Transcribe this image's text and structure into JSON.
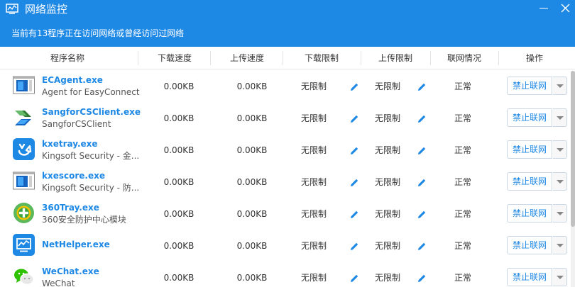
{
  "window": {
    "title": "网络监控",
    "subtitle": "当前有13程序正在访问网络或曾经访问过网络",
    "accent": "#1e88e5"
  },
  "header": {
    "program": "程序名称",
    "download_speed": "下载速度",
    "upload_speed": "上传速度",
    "download_limit": "下载限制",
    "upload_limit": "上传限制",
    "net_status": "联网情况",
    "action": "操作"
  },
  "rows": [
    {
      "name": "ECAgent.exe",
      "desc": "Agent for EasyConnect",
      "icon": "ecagent-icon",
      "down": "0.00KB",
      "up": "0.00KB",
      "dl_limit": "无限制",
      "ul_limit": "无限制",
      "status": "正常",
      "action": "禁止联网"
    },
    {
      "name": "SangforCSClient.exe",
      "desc": "SangforCSClient",
      "icon": "sangfor-icon",
      "down": "0.00KB",
      "up": "0.00KB",
      "dl_limit": "无限制",
      "ul_limit": "无限制",
      "status": "正常",
      "action": "禁止联网"
    },
    {
      "name": "kxetray.exe",
      "desc": "Kingsoft Security - 金...",
      "icon": "kxetray-icon",
      "down": "0.00KB",
      "up": "0.00KB",
      "dl_limit": "无限制",
      "ul_limit": "无限制",
      "status": "正常",
      "action": "禁止联网"
    },
    {
      "name": "kxescore.exe",
      "desc": "Kingsoft Security - 防...",
      "icon": "kxescore-icon",
      "down": "0.00KB",
      "up": "0.00KB",
      "dl_limit": "无限制",
      "ul_limit": "无限制",
      "status": "正常",
      "action": "禁止联网"
    },
    {
      "name": "360Tray.exe",
      "desc": "360安全防护中心模块",
      "icon": "360-icon",
      "down": "0.00KB",
      "up": "0.00KB",
      "dl_limit": "无限制",
      "ul_limit": "无限制",
      "status": "正常",
      "action": "禁止联网"
    },
    {
      "name": "NetHelper.exe",
      "desc": "",
      "icon": "nethelper-icon",
      "down": "0.00KB",
      "up": "0.00KB",
      "dl_limit": "无限制",
      "ul_limit": "无限制",
      "status": "正常",
      "action": "禁止联网"
    },
    {
      "name": "WeChat.exe",
      "desc": "WeChat",
      "icon": "wechat-icon",
      "down": "0.00KB",
      "up": "0.00KB",
      "dl_limit": "无限制",
      "ul_limit": "无限制",
      "status": "正常",
      "action": "禁止联网"
    }
  ]
}
